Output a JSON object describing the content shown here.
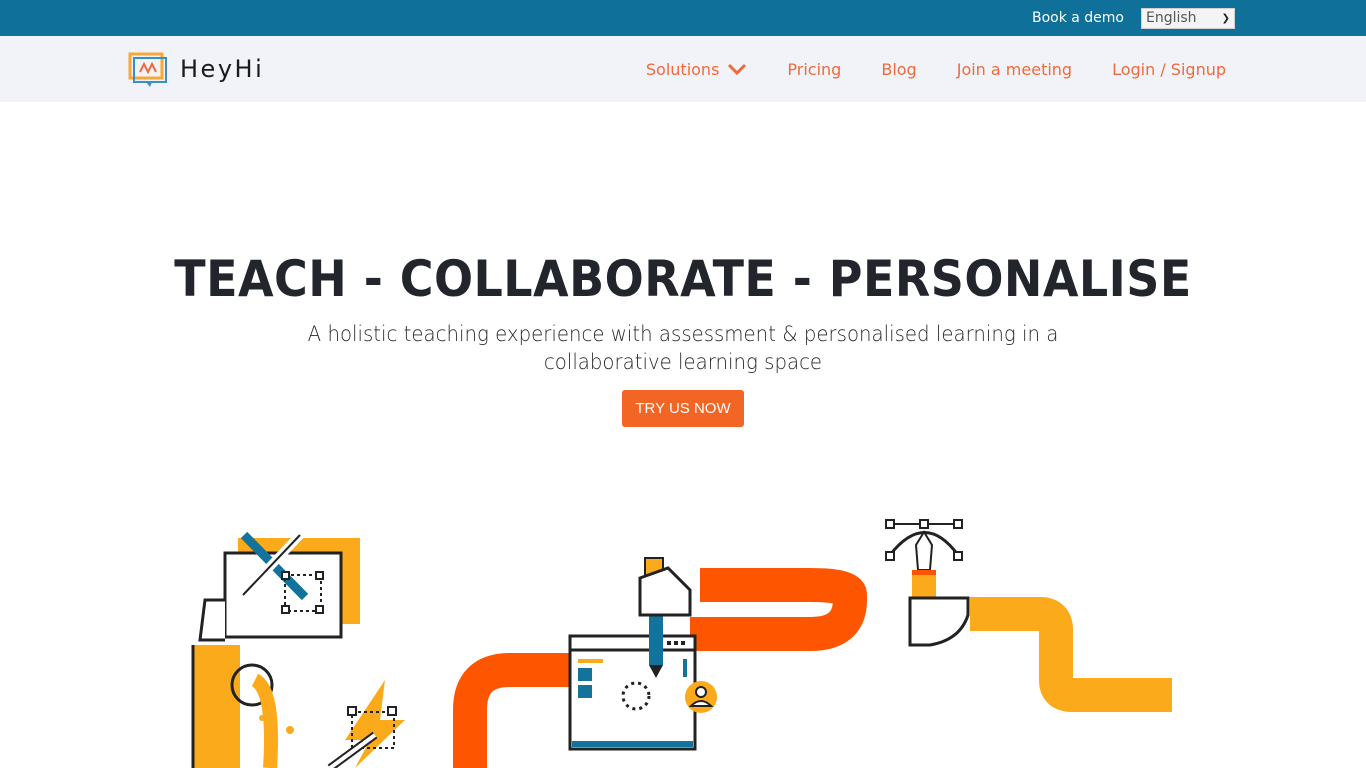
{
  "topbar": {
    "book_demo_label": "Book a demo",
    "language_selected": "English"
  },
  "navbar": {
    "logo_text": "HeyHi",
    "items": [
      {
        "label": "Solutions",
        "has_dropdown": true
      },
      {
        "label": "Pricing"
      },
      {
        "label": "Blog"
      },
      {
        "label": "Join a meeting"
      },
      {
        "label": "Login / Signup"
      }
    ]
  },
  "hero": {
    "title": "TEACH - COLLABORATE - PERSONALISE",
    "subtitle": "A holistic teaching experience with assessment & personalised learning in a collaborative learning space",
    "cta_label": "TRY US NOW"
  },
  "colors": {
    "topbar_bg": "#0f7199",
    "nav_link": "#ef6a3a",
    "cta_bg": "#f26524",
    "accent_orange": "#fe5500",
    "accent_yellow": "#fbaa1c",
    "accent_blue": "#12739c"
  }
}
